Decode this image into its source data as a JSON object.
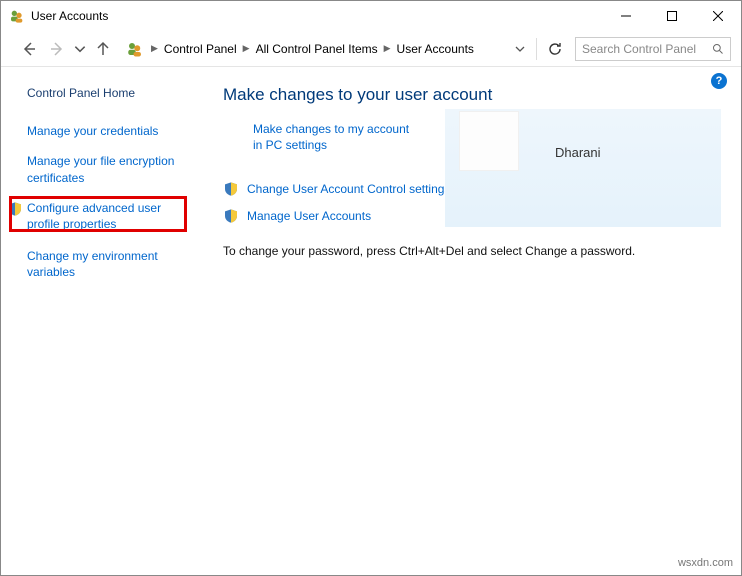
{
  "window": {
    "title": "User Accounts"
  },
  "breadcrumb": {
    "crumb1": "Control Panel",
    "crumb2": "All Control Panel Items",
    "crumb3": "User Accounts"
  },
  "search": {
    "placeholder": "Search Control Panel"
  },
  "sidebar": {
    "home": "Control Panel Home",
    "link1": "Manage your credentials",
    "link2": "Manage your file encryption certificates",
    "link3": "Configure advanced user profile properties",
    "link4": "Change my environment variables"
  },
  "main": {
    "heading": "Make changes to your user account",
    "pcsettings": "Make changes to my account in PC settings",
    "uac": "Change User Account Control settings",
    "manage": "Manage User Accounts",
    "instructions": "To change your password, press Ctrl+Alt+Del and select Change a password."
  },
  "user": {
    "name": "Dharani"
  },
  "watermark": "wsxdn.com"
}
